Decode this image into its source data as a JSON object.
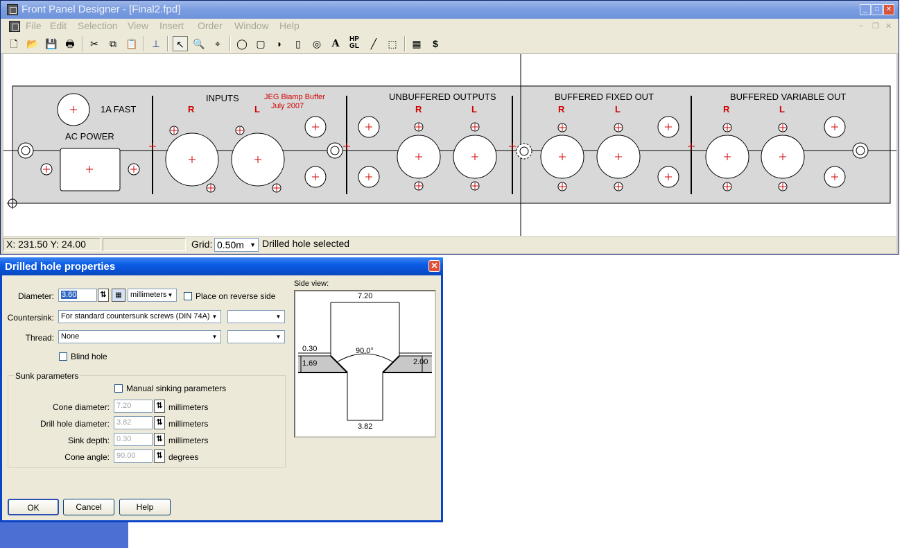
{
  "app": {
    "title": "Front Panel Designer - [Final2.fpd]",
    "menu": [
      "File",
      "Edit",
      "Selection",
      "View",
      "Insert",
      "Order",
      "Window",
      "Help"
    ]
  },
  "toolbar": {
    "icons": [
      "new-file-icon",
      "open-folder-icon",
      "save-icon",
      "print-icon",
      "cut-icon",
      "copy-icon",
      "paste-icon",
      "panel-icon",
      "pointer-icon",
      "zoom-icon",
      "crosshair-icon",
      "drilled-hole-icon",
      "rect-cutout-icon",
      "d-cutout-icon",
      "double-d-icon",
      "countersink-icon",
      "text-icon",
      "hpgl-icon",
      "line-icon",
      "bolt-icon",
      "grid-icon",
      "price-icon"
    ],
    "text_tool": "A",
    "hpgl_label": "HP GL"
  },
  "panel": {
    "labels": {
      "fuse": "1A FAST",
      "ac_power": "AC POWER",
      "inputs": "INPUTS",
      "title_line1": "JEG Biamp Buffer",
      "title_line2": "July 2007",
      "unbuffered": "UNBUFFERED OUTPUTS",
      "buffered_fixed": "BUFFERED FIXED OUT",
      "buffered_variable": "BUFFERED VARIABLE OUT",
      "r": "R",
      "l": "L"
    }
  },
  "status": {
    "coords": "X: 231.50  Y: 24.00",
    "grid_label": "Grid:",
    "grid_value": "0.50m",
    "message": "Drilled hole selected"
  },
  "dialog": {
    "title": "Drilled hole properties",
    "diameter_label": "Diameter:",
    "diameter_value": "3.60",
    "units": "millimeters",
    "reverse_label": "Place on reverse side",
    "countersink_label": "Countersink:",
    "countersink_value": "For standard countersunk screws (DIN 74A)",
    "thread_label": "Thread:",
    "thread_value": "None",
    "blind_label": "Blind hole",
    "sunk_group": "Sunk parameters",
    "manual_label": "Manual sinking parameters",
    "cone_diameter_label": "Cone diameter:",
    "cone_diameter_value": "7.20",
    "drill_diameter_label": "Drill hole diameter:",
    "drill_diameter_value": "3.82",
    "sink_depth_label": "Sink depth:",
    "sink_depth_value": "0.30",
    "cone_angle_label": "Cone angle:",
    "cone_angle_value": "90.00",
    "unit_mm": "millimeters",
    "unit_deg": "degrees",
    "side_view_label": "Side view:",
    "side_view": {
      "top_width": "7.20",
      "angle": "90.0°",
      "sink": "0.30",
      "left_thickness": "1.69",
      "right_thickness": "2.00",
      "bottom_width": "3.82"
    },
    "ok": "OK",
    "cancel": "Cancel",
    "help": "Help"
  }
}
